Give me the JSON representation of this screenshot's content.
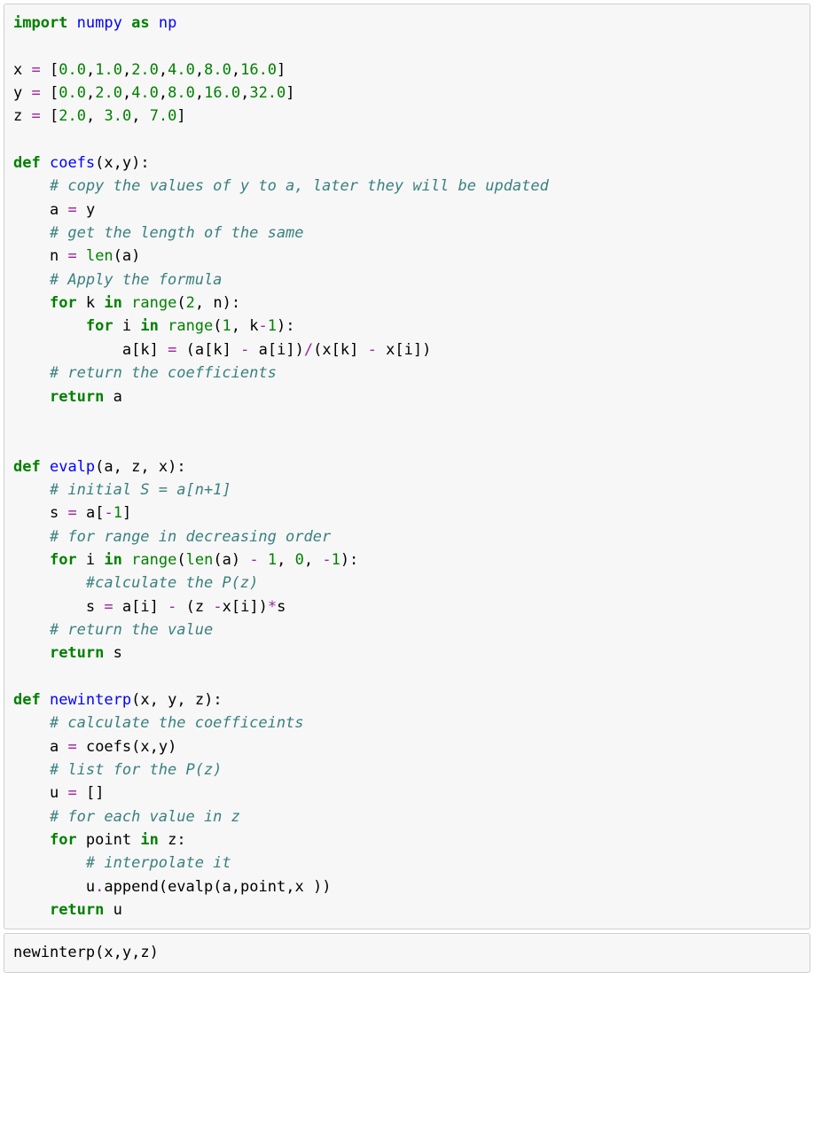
{
  "L01_kw_import": "import",
  "L01_nn_numpy": "numpy",
  "L01_kw_as": "as",
  "L01_nn_np": "np",
  "L02_blank": "",
  "L03_id_x": "x",
  "L03_op_eq": "=",
  "L03_p_ob": "[",
  "L03_n_0": "0.0",
  "L03_p_c1": ",",
  "L03_n_1": "1.0",
  "L03_p_c2": ",",
  "L03_n_2": "2.0",
  "L03_p_c3": ",",
  "L03_n_4": "4.0",
  "L03_p_c4": ",",
  "L03_n_8": "8.0",
  "L03_p_c5": ",",
  "L03_n_16": "16.0",
  "L03_p_cb": "]",
  "L04_id_y": "y",
  "L04_op_eq": "=",
  "L04_p_ob": "[",
  "L04_n_0": "0.0",
  "L04_p_c1": ",",
  "L04_n_2": "2.0",
  "L04_p_c2": ",",
  "L04_n_4": "4.0",
  "L04_p_c3": ",",
  "L04_n_8": "8.0",
  "L04_p_c4": ",",
  "L04_n_16": "16.0",
  "L04_p_c5": ",",
  "L04_n_32": "32.0",
  "L04_p_cb": "]",
  "L05_id_z": "z",
  "L05_op_eq": "=",
  "L05_p_ob": "[",
  "L05_n_2": "2.0",
  "L05_p_c1": ",",
  "L05_sp1": " ",
  "L05_n_3": "3.0",
  "L05_p_c2": ",",
  "L05_sp2": " ",
  "L05_n_7": "7.0",
  "L05_p_cb": "]",
  "L06_blank": "",
  "L07_kw_def": "def",
  "L07_fn": "coefs",
  "L07_p_op": "(",
  "L07_id_x": "x",
  "L07_p_c": ",",
  "L07_id_y": "y",
  "L07_p_cp": "):",
  "L08_ind": "    ",
  "L08_cm": "# copy the values of y to a, later they will be updated",
  "L09_ind": "    ",
  "L09_id_a": "a",
  "L09_op_eq": "=",
  "L09_id_y": "y",
  "L10_ind": "    ",
  "L10_cm": "# get the length of the same",
  "L11_ind": "    ",
  "L11_id_n": "n",
  "L11_op_eq": "=",
  "L11_bi": "len",
  "L11_p_op": "(",
  "L11_id_a": "a",
  "L11_p_cp": ")",
  "L12_ind": "    ",
  "L12_cm": "# Apply the formula",
  "L13_ind": "    ",
  "L13_kw_for": "for",
  "L13_id_k": "k",
  "L13_kw_in": "in",
  "L13_bi": "range",
  "L13_p_op": "(",
  "L13_n_2": "2",
  "L13_p_c": ",",
  "L13_sp": " ",
  "L13_id_n": "n",
  "L13_p_cp": "):",
  "L14_ind": "        ",
  "L14_kw_for": "for",
  "L14_id_i": "i",
  "L14_kw_in": "in",
  "L14_bi": "range",
  "L14_p_op": "(",
  "L14_n_1": "1",
  "L14_p_c": ",",
  "L14_sp": " ",
  "L14_id_k": "k",
  "L14_op_m": "-",
  "L14_n_1b": "1",
  "L14_p_cp": "):",
  "L15_ind": "            ",
  "L15_id_a": "a",
  "L15_p_ob": "[",
  "L15_id_k": "k",
  "L15_p_cb": "]",
  "L15_sp1": " ",
  "L15_op_eq": "=",
  "L15_sp2": " ",
  "L15_p_op": "(",
  "L15_id_a2": "a",
  "L15_p_ob2": "[",
  "L15_id_k2": "k",
  "L15_p_cb2": "]",
  "L15_sp3": " ",
  "L15_op_m": "-",
  "L15_sp4": " ",
  "L15_id_a3": "a",
  "L15_p_ob3": "[",
  "L15_id_i": "i",
  "L15_p_cb3": "]",
  "L15_p_cp": ")",
  "L15_op_d": "/",
  "L15_p_op2": "(",
  "L15_id_x": "x",
  "L15_p_ob4": "[",
  "L15_id_k3": "k",
  "L15_p_cb4": "]",
  "L15_sp5": " ",
  "L15_op_m2": "-",
  "L15_sp6": " ",
  "L15_id_x2": "x",
  "L15_p_ob5": "[",
  "L15_id_i2": "i",
  "L15_p_cb5": "]",
  "L15_p_cp2": ")",
  "L16_ind": "    ",
  "L16_cm": "# return the coefficients",
  "L17_ind": "    ",
  "L17_kw": "return",
  "L17_id": "a",
  "L18_blank": "",
  "L19_blank": "",
  "L20_kw_def": "def",
  "L20_fn": "evalp",
  "L20_p_op": "(",
  "L20_id_a": "a",
  "L20_p_c1": ",",
  "L20_sp1": " ",
  "L20_id_z": "z",
  "L20_p_c2": ",",
  "L20_sp2": " ",
  "L20_id_x": "x",
  "L20_p_cp": "):",
  "L21_ind": "    ",
  "L21_cm": "# initial S = a[n+1]",
  "L22_ind": "    ",
  "L22_id_s": "s",
  "L22_op_eq": "=",
  "L22_id_a": "a",
  "L22_p_ob": "[",
  "L22_op_m": "-",
  "L22_n_1": "1",
  "L22_p_cb": "]",
  "L23_ind": "    ",
  "L23_cm": "# for range in decreasing order",
  "L24_ind": "    ",
  "L24_kw_for": "for",
  "L24_id_i": "i",
  "L24_kw_in": "in",
  "L24_bi": "range",
  "L24_p_op": "(",
  "L24_bi2": "len",
  "L24_p_op2": "(",
  "L24_id_a": "a",
  "L24_p_cp2": ")",
  "L24_sp1": " ",
  "L24_op_m": "-",
  "L24_sp2": " ",
  "L24_n_1": "1",
  "L24_p_c1": ",",
  "L24_sp3": " ",
  "L24_n_0": "0",
  "L24_p_c2": ",",
  "L24_sp4": " ",
  "L24_op_m2": "-",
  "L24_n_1b": "1",
  "L24_p_cp": "):",
  "L25_ind": "        ",
  "L25_cm": "#calculate the P(z)",
  "L26_ind": "        ",
  "L26_id_s": "s",
  "L26_sp1": " ",
  "L26_op_eq": "=",
  "L26_sp2": " ",
  "L26_id_a": "a",
  "L26_p_ob": "[",
  "L26_id_i": "i",
  "L26_p_cb": "]",
  "L26_sp3": " ",
  "L26_op_m": "-",
  "L26_sp4": " ",
  "L26_p_op": "(",
  "L26_id_z": "z",
  "L26_sp5": " ",
  "L26_op_m2": "-",
  "L26_id_x": "x",
  "L26_p_ob2": "[",
  "L26_id_i2": "i",
  "L26_p_cb2": "]",
  "L26_p_cp": ")",
  "L26_op_t": "*",
  "L26_id_s2": "s",
  "L27_ind": "    ",
  "L27_cm": "# return the value",
  "L28_ind": "    ",
  "L28_kw": "return",
  "L28_id": "s",
  "L29_blank": "",
  "L30_kw_def": "def",
  "L30_fn": "newinterp",
  "L30_p_op": "(",
  "L30_id_x": "x",
  "L30_p_c1": ",",
  "L30_sp1": " ",
  "L30_id_y": "y",
  "L30_p_c2": ",",
  "L30_sp2": " ",
  "L30_id_z": "z",
  "L30_p_cp": "):",
  "L31_ind": "    ",
  "L31_cm": "# calculate the coefficeints",
  "L32_ind": "    ",
  "L32_id_a": "a",
  "L32_op_eq": "=",
  "L32_fn": "coefs",
  "L32_p_op": "(",
  "L32_id_x": "x",
  "L32_p_c": ",",
  "L32_id_y": "y",
  "L32_p_cp": ")",
  "L33_ind": "    ",
  "L33_cm": "# list for the P(z)",
  "L34_ind": "    ",
  "L34_id_u": "u",
  "L34_op_eq": "=",
  "L34_p_ob": "[",
  "L34_p_cb": "]",
  "L35_ind": "    ",
  "L35_cm": "# for each value in z",
  "L36_ind": "    ",
  "L36_kw_for": "for",
  "L36_id_p": "point",
  "L36_kw_in": "in",
  "L36_id_z": "z",
  "L36_p_c": ":",
  "L37_ind": "        ",
  "L37_cm": "# interpolate it",
  "L38_ind": "        ",
  "L38_id_u": "u",
  "L38_op_d": ".",
  "L38_id_ap": "append",
  "L38_p_op": "(",
  "L38_fn": "evalp",
  "L38_p_op2": "(",
  "L38_id_a": "a",
  "L38_p_c1": ",",
  "L38_id_pt": "point",
  "L38_p_c2": ",",
  "L38_id_x": "x",
  "L38_sp": " ",
  "L38_p_cp2": ")",
  "L38_p_cp": ")",
  "L39_ind": "    ",
  "L39_kw": "return",
  "L39_id": "u",
  "C2_call": "newinterp",
  "C2_p_op": "(",
  "C2_id_x": "x",
  "C2_p_c1": ",",
  "C2_id_y": "y",
  "C2_p_c2": ",",
  "C2_id_z": "z",
  "C2_p_cp": ")"
}
